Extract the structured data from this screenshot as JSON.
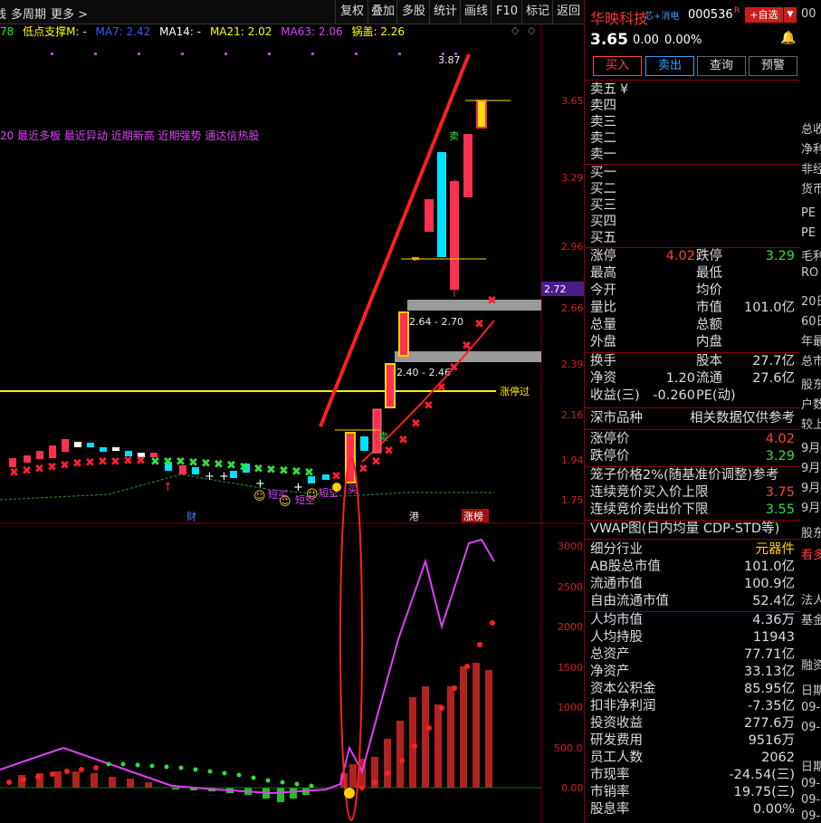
{
  "topbar": {
    "left_items": [
      "线",
      "多周期",
      "更多 >"
    ],
    "buttons": [
      "复权",
      "叠加",
      "多股",
      "统计",
      "画线",
      "F10",
      "标记",
      "返回"
    ]
  },
  "legend": [
    {
      "text": "78",
      "color": "#00ff00"
    },
    {
      "text": "低点支撑M: -",
      "color": "#ffff00"
    },
    {
      "text": "MA7: 2.42",
      "color": "#3060ff"
    },
    {
      "text": "MA14: -",
      "color": "#ffffff"
    },
    {
      "text": "MA21: 2.02",
      "color": "#ffff00"
    },
    {
      "text": "MA63: 2.06",
      "color": "#e040fb"
    },
    {
      "text": "锅盖: 2.26",
      "color": "#ffff00"
    }
  ],
  "hot_line": "20 最近多板 最近异动 近期新高 近期强势 通达信热股",
  "chart": {
    "price_axis": [
      "3.65",
      "3.29",
      "2.96",
      "2.66",
      "2.39",
      "2.16",
      "1.94",
      "1.75"
    ],
    "current_price_tag": "2.72",
    "peak_label": "3.87",
    "box_labels": [
      "2.64 - 2.70",
      "2.40 - 2.46"
    ],
    "limit_line_label": "涨停过",
    "date_markers": [
      "财",
      "港",
      "涨榜"
    ],
    "signals": [
      "短买",
      "短空",
      "短空",
      "卖",
      "卖",
      "买"
    ],
    "indicator_axis": [
      "3000",
      "2500",
      "2000",
      "1500",
      "1000",
      "500.0",
      "0.00"
    ]
  },
  "chart_data": {
    "type": "line",
    "title": "",
    "price_ticks": [
      3.65,
      3.29,
      2.96,
      2.66,
      2.39,
      2.16,
      1.94,
      1.75
    ],
    "recent_candles": [
      {
        "open": 1.94,
        "close": 2.1,
        "high": 2.12,
        "low": 1.9
      },
      {
        "open": 2.0,
        "close": 2.12,
        "high": 2.15,
        "low": 1.98
      },
      {
        "open": 2.16,
        "close": 2.31,
        "high": 2.31,
        "low": 2.16
      },
      {
        "open": 2.54,
        "close": 2.54,
        "high": 2.56,
        "low": 2.49
      },
      {
        "open": 2.54,
        "close": 2.76,
        "high": 2.8,
        "low": 2.54
      },
      {
        "open": 3.02,
        "close": 3.25,
        "high": 3.3,
        "low": 3.0
      },
      {
        "open": 2.96,
        "close": 3.38,
        "high": 3.52,
        "low": 2.94
      },
      {
        "open": 3.0,
        "close": 3.4,
        "high": 3.42,
        "low": 2.98
      },
      {
        "open": 3.22,
        "close": 3.5,
        "high": 3.55,
        "low": 3.1
      },
      {
        "open": 3.65,
        "close": 3.52,
        "high": 3.87,
        "low": 3.46
      }
    ],
    "indicator_ticks": [
      3000,
      2500,
      2000,
      1500,
      1000,
      500,
      0
    ]
  },
  "stock": {
    "name": "华映科技",
    "tag": "芯+消电",
    "code": "000536",
    "flag": "R",
    "add_label": "+自选",
    "price": "3.65",
    "change": "0.00",
    "change_pct": "0.00%"
  },
  "trade_buttons": [
    "买入",
    "卖出",
    "查询",
    "预警"
  ],
  "orderbook": {
    "sell": [
      "卖五",
      "卖四",
      "卖三",
      "卖二",
      "卖一"
    ],
    "buy": [
      "买一",
      "买二",
      "买三",
      "买四",
      "买五"
    ],
    "yen": "¥"
  },
  "quote": {
    "r1": {
      "k": "涨停",
      "v": "4.02",
      "k2": "跌停",
      "v2": "3.29"
    },
    "r2": {
      "k": "最高",
      "k2": "最低"
    },
    "r3": {
      "k": "今开",
      "k2": "均价"
    },
    "r4": {
      "k": "量比",
      "k2": "市值",
      "v2": "101.0亿"
    },
    "r5": {
      "k": "总量",
      "k2": "总额"
    },
    "r6": {
      "k": "外盘",
      "k2": "内盘"
    },
    "r7": {
      "k": "换手",
      "v": "27.7亿",
      "k2": "股本"
    },
    "r8": {
      "k": "净资",
      "v1": "1.20",
      "k2": "流通",
      "v2": "27.6亿"
    },
    "r9": {
      "k": "收益(三)",
      "v1": "-0.260",
      "k2": "PE(动)"
    }
  },
  "market": {
    "title": "深市品种",
    "note": "相关数据仅供参考",
    "up_label": "涨停价",
    "up": "4.02",
    "down_label": "跌停价",
    "down": "3.29",
    "cage": "笼子价格2%(随基准价调整)参考",
    "auc_buy_label": "连续竞价买入价上限",
    "auc_buy": "3.75",
    "auc_sell_label": "连续竞价卖出价下限",
    "auc_sell": "3.55",
    "vwap": "VWAP图(日内均量 CDP-STD等)"
  },
  "fundamentals": [
    {
      "k": "细分行业",
      "v": "元器件"
    },
    {
      "k": "AB股总市值",
      "v": "101.0亿"
    },
    {
      "k": "流通市值",
      "v": "100.9亿"
    },
    {
      "k": "自由流通市值",
      "v": "52.4亿"
    },
    {
      "k": "人均市值",
      "v": "4.36万"
    },
    {
      "k": "人均持股",
      "v": "11943"
    },
    {
      "k": "总资产",
      "v": "77.71亿"
    },
    {
      "k": "净资产",
      "v": "33.13亿"
    },
    {
      "k": "资本公积金",
      "v": "85.95亿"
    },
    {
      "k": "扣非净利润",
      "v": "-7.35亿"
    },
    {
      "k": "投资收益",
      "v": "277.6万"
    },
    {
      "k": "研发费用",
      "v": "9516万"
    },
    {
      "k": "员工人数",
      "v": "2062"
    },
    {
      "k": "市现率",
      "v": "-24.54(三)"
    },
    {
      "k": "市销率",
      "v": "19.75(三)"
    },
    {
      "k": "股息率",
      "v": "0.00%"
    }
  ],
  "edge_text": [
    "00",
    "总收",
    "净利",
    "非经",
    "货币",
    "PE",
    "PE",
    "毛利",
    "RO",
    "20日",
    "60日",
    "年最",
    "总市",
    "股东",
    "户数",
    "较上",
    "9月",
    "9月",
    "9月",
    "9月",
    "股东",
    "看多",
    "法人",
    "基金",
    "融资",
    "日期",
    "09-",
    "09-",
    "日期",
    "09-",
    "09-",
    "09-"
  ]
}
